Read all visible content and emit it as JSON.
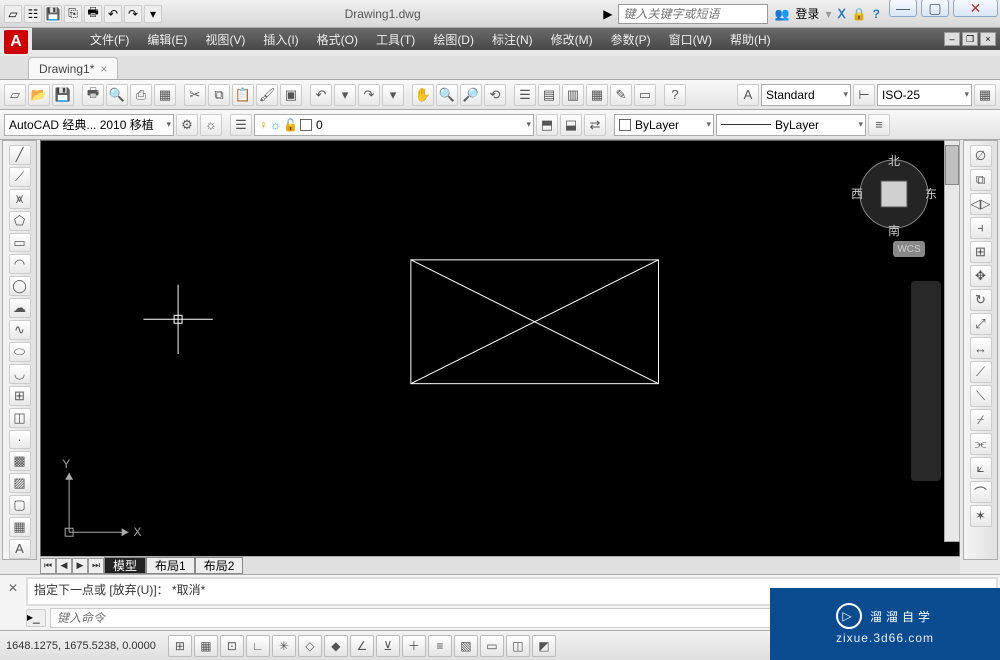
{
  "title": "Drawing1.dwg",
  "search_placeholder": "键入关键字或短语",
  "login_label": "登录",
  "menus": [
    "文件(F)",
    "编辑(E)",
    "视图(V)",
    "插入(I)",
    "格式(O)",
    "工具(T)",
    "绘图(D)",
    "标注(N)",
    "修改(M)",
    "参数(P)",
    "窗口(W)",
    "帮助(H)"
  ],
  "filetab": "Drawing1*",
  "style_label": "Standard",
  "dim_label": "ISO-25",
  "workspace_label": "AutoCAD 经典... 2010 移植",
  "layer_label": "0",
  "bylayer_label": "ByLayer",
  "linetype_label": "ByLayer",
  "compass": {
    "n": "北",
    "s": "南",
    "e": "东",
    "w": "西"
  },
  "wcs": "WCS",
  "layout_tabs": [
    "模型",
    "布局1",
    "布局2"
  ],
  "cmd_output": "指定下一点或 [放弃(U)]： *取消*",
  "cmd_placeholder": "键入命令",
  "coords": "1648.1275, 1675.5238, 0.0000",
  "watermark": {
    "main": "溜溜自学",
    "sub": "zixue.3d66.com"
  },
  "ucs": {
    "x": "X",
    "y": "Y"
  }
}
